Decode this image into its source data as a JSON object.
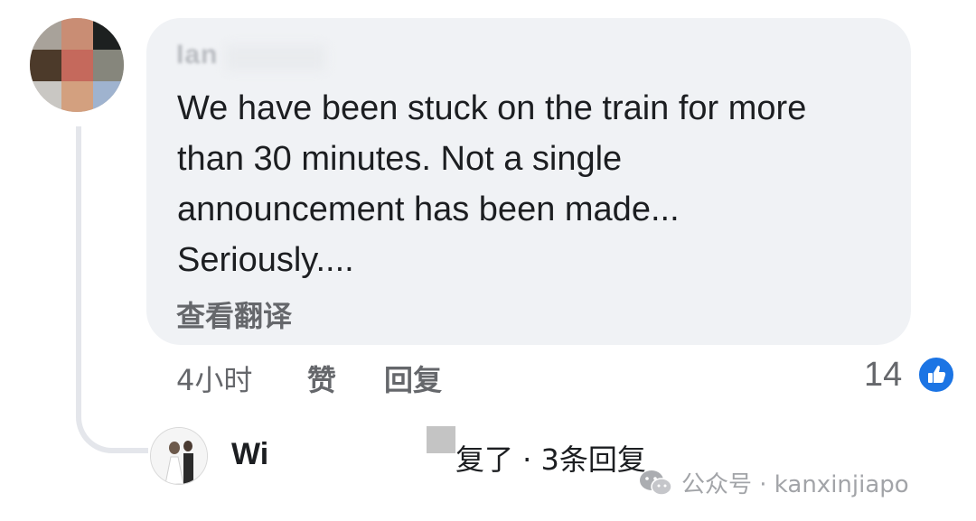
{
  "comment": {
    "author_name": "Ian",
    "text": "We have been stuck on the train for more\nthan 30 minutes. Not a single\nannouncement has been made...\nSeriously....",
    "translate_label": "查看翻译"
  },
  "actions": {
    "time": "4小时",
    "like_label": "赞",
    "reply_label": "回复"
  },
  "reactions": {
    "count": "14",
    "type": "like-icon",
    "color": "#1b74e4"
  },
  "reply_preview": {
    "replier_name": "Wi",
    "summary": "复了 · 3条回复"
  },
  "watermark": {
    "label": "公众号 · kanxinjiapo",
    "icon": "wechat-icon"
  }
}
